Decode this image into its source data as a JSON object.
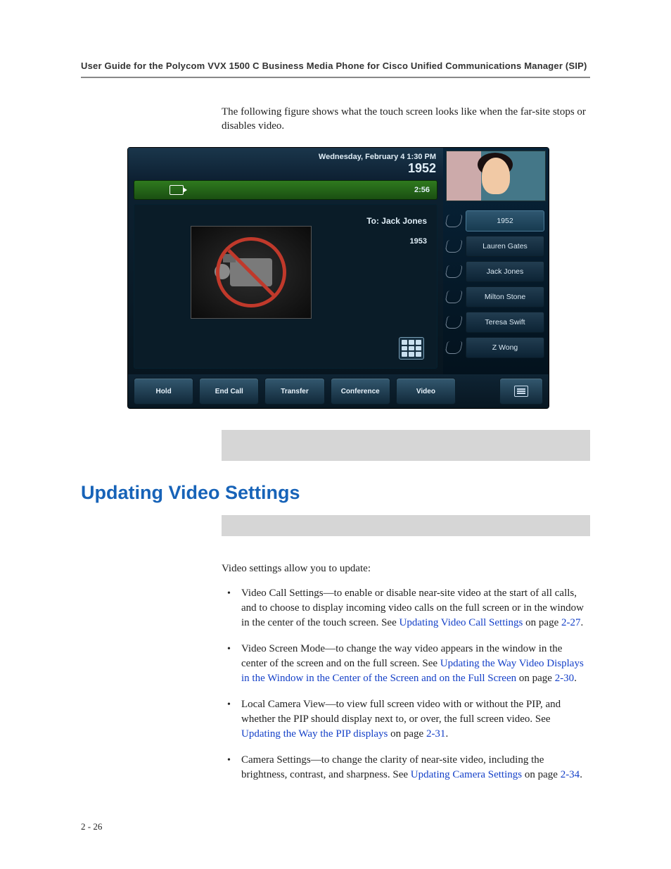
{
  "header": {
    "title": "User Guide for the Polycom VVX 1500 C Business Media Phone for Cisco Unified Communications Manager (SIP)"
  },
  "intro": "The following figure shows what the touch screen looks like when the far-site stops or disables video.",
  "phone": {
    "date": "Wednesday, February 4  1:30 PM",
    "extension": "1952",
    "call_duration": "2:56",
    "to_label": "To: Jack Jones",
    "to_number": "1953",
    "contacts": [
      {
        "label": "1952",
        "active": true
      },
      {
        "label": "Lauren Gates",
        "active": false
      },
      {
        "label": "Jack Jones",
        "active": false
      },
      {
        "label": "Milton Stone",
        "active": false
      },
      {
        "label": "Teresa Swift",
        "active": false
      },
      {
        "label": "Z Wong",
        "active": false
      }
    ],
    "softkeys": [
      "Hold",
      "End Call",
      "Transfer",
      "Conference",
      "Video"
    ]
  },
  "section": {
    "heading": "Updating Video Settings",
    "lead": "Video settings allow you to update:",
    "items": [
      {
        "pre": "Video Call Settings—to enable or disable near-site video at the start of all calls, and to choose to display incoming video calls on the full screen or in the window in the center of the touch screen. See ",
        "link": "Updating Video Call Settings",
        "mid": " on page ",
        "page": "2-27",
        "post": "."
      },
      {
        "pre": "Video Screen Mode—to change the way video appears in the window in the center of the screen and on the full screen. See ",
        "link": "Updating the Way Video Displays in the Window in the Center of the Screen and on the Full Screen",
        "mid": " on page ",
        "page": "2-30",
        "post": "."
      },
      {
        "pre": "Local Camera View—to view full screen video with or without the PIP, and whether the PIP should display next to, or over, the full screen video. See ",
        "link": "Updating the Way the PIP displays",
        "mid": " on page ",
        "page": "2-31",
        "post": "."
      },
      {
        "pre": "Camera Settings—to change the clarity of near-site video, including the brightness, contrast, and sharpness. See ",
        "link": "Updating Camera Settings",
        "mid": " on page ",
        "page": "2-34",
        "post": "."
      }
    ]
  },
  "footer": {
    "page": "2 - 26"
  }
}
